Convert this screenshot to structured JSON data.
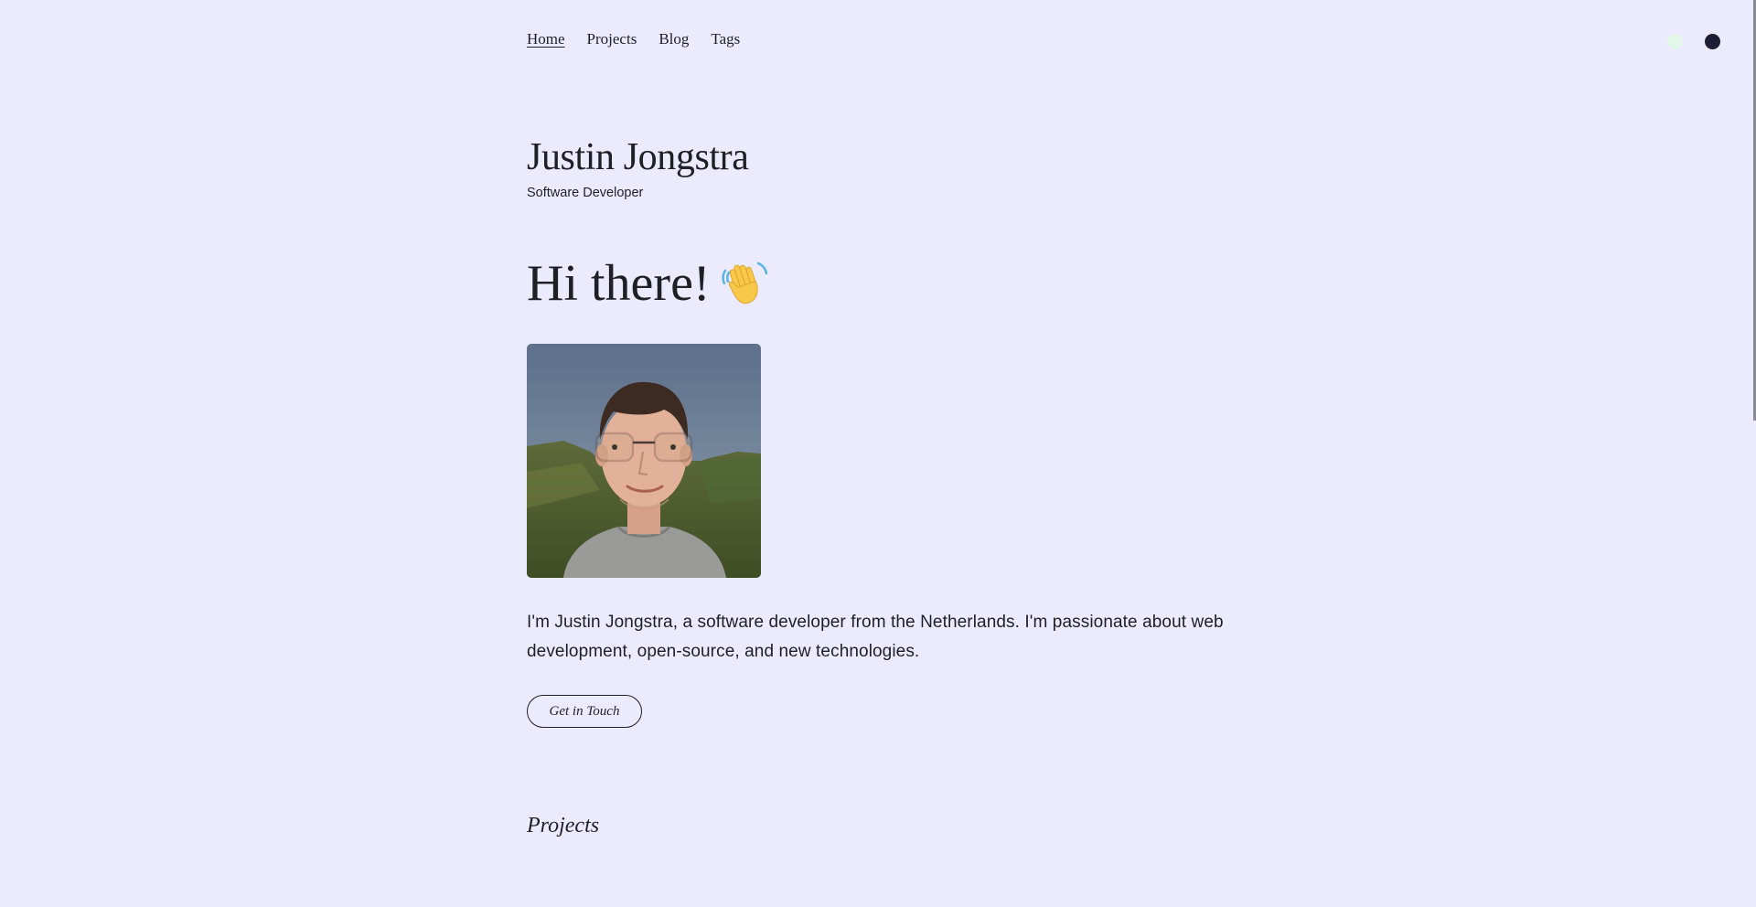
{
  "nav": {
    "items": [
      {
        "label": "Home",
        "active": true
      },
      {
        "label": "Projects",
        "active": false
      },
      {
        "label": "Blog",
        "active": false
      },
      {
        "label": "Tags",
        "active": false
      }
    ]
  },
  "theme_toggle": {
    "light_icon": "light-theme-dot",
    "dark_icon": "dark-theme-dot",
    "colors": {
      "light": "#e3f6ea",
      "dark": "#1f1d33"
    }
  },
  "header": {
    "name": "Justin Jongstra",
    "role": "Software Developer"
  },
  "hero": {
    "greeting": "Hi there!",
    "emoji_icon": "waving-hand-icon"
  },
  "profile": {
    "photo": "profile-photo"
  },
  "bio": {
    "text": "I'm Justin Jongstra, a software developer from the Netherlands. I'm passionate about web development, open-source, and new technologies."
  },
  "cta": {
    "label": "Get in Touch"
  },
  "sections": {
    "projects_title": "Projects"
  },
  "colors": {
    "background": "#ecebfd",
    "text": "#1f1f24"
  }
}
